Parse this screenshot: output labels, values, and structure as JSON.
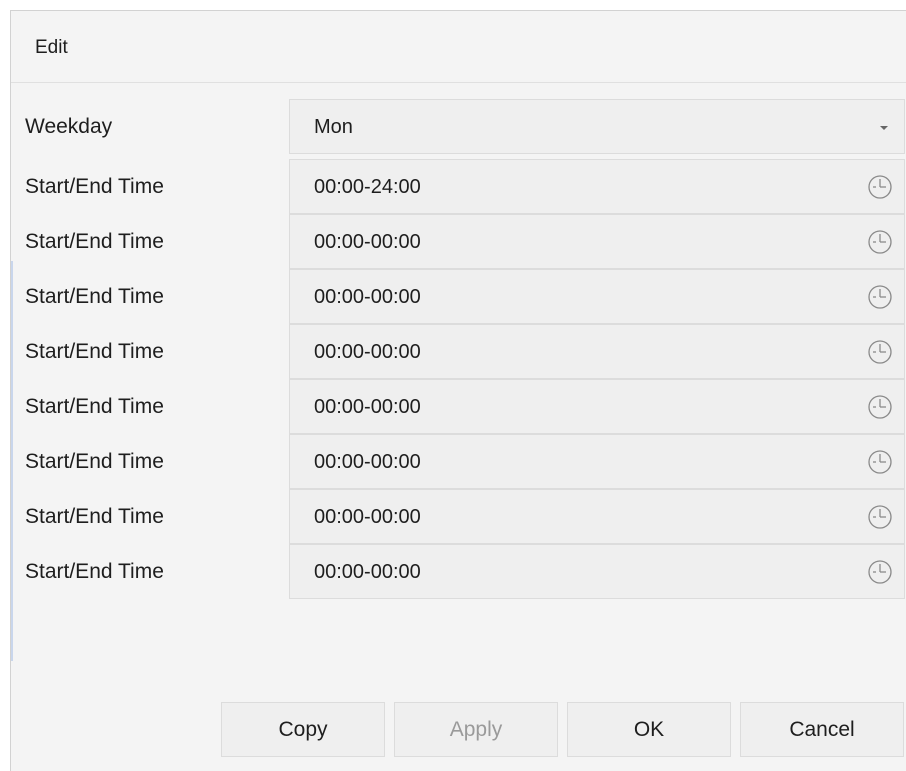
{
  "dialog": {
    "title": "Edit"
  },
  "weekday": {
    "label": "Weekday",
    "value": "Mon"
  },
  "time_rows": [
    {
      "label": "Start/End Time",
      "value": "00:00-24:00"
    },
    {
      "label": "Start/End Time",
      "value": "00:00-00:00"
    },
    {
      "label": "Start/End Time",
      "value": "00:00-00:00"
    },
    {
      "label": "Start/End Time",
      "value": "00:00-00:00"
    },
    {
      "label": "Start/End Time",
      "value": "00:00-00:00"
    },
    {
      "label": "Start/End Time",
      "value": "00:00-00:00"
    },
    {
      "label": "Start/End Time",
      "value": "00:00-00:00"
    },
    {
      "label": "Start/End Time",
      "value": "00:00-00:00"
    }
  ],
  "buttons": {
    "copy": "Copy",
    "apply": "Apply",
    "ok": "OK",
    "cancel": "Cancel"
  },
  "icons": {
    "time_picker": "clock-icon",
    "dropdown": "chevron-down-icon"
  }
}
